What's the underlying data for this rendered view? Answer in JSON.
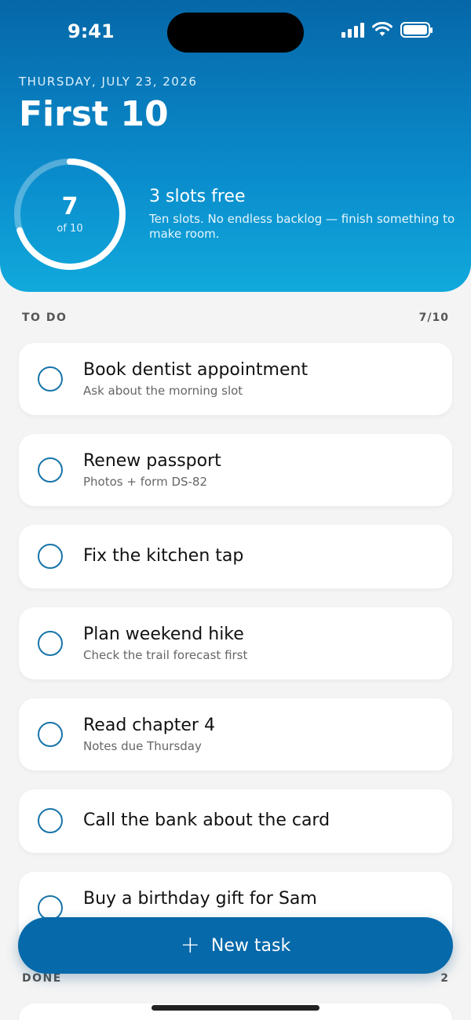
{
  "status_bar": {
    "time": "9:41"
  },
  "header": {
    "date": "THURSDAY, JULY 23, 2026",
    "title": "First 10",
    "progress": {
      "count": "7",
      "of_label": "of 10",
      "fraction": 0.7
    },
    "slots_free": "3 slots free",
    "description": "Ten slots. No endless backlog — finish something to make room."
  },
  "todo": {
    "label": "TO DO",
    "count": "7/10",
    "tasks": [
      {
        "title": "Book dentist appointment",
        "note": "Ask about the morning slot"
      },
      {
        "title": "Renew passport",
        "note": "Photos + form DS-82"
      },
      {
        "title": "Fix the kitchen tap",
        "note": ""
      },
      {
        "title": "Plan weekend hike",
        "note": "Check the trail forecast first"
      },
      {
        "title": "Read chapter 4",
        "note": "Notes due Thursday"
      },
      {
        "title": "Call the bank about the card",
        "note": ""
      },
      {
        "title": "Buy a birthday gift for Sam",
        "note": ""
      }
    ]
  },
  "done": {
    "label": "DONE",
    "count": "2"
  },
  "new_task_button": {
    "label": "New task"
  },
  "colors": {
    "accent": "#0569aa",
    "header_top": "#0667a8",
    "header_bottom": "#11a9dc"
  }
}
